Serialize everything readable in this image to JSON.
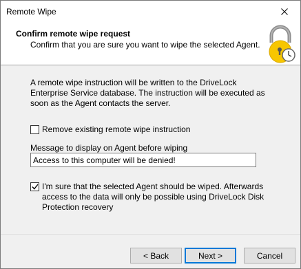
{
  "window": {
    "title": "Remote Wipe",
    "close_icon": "close-icon"
  },
  "header": {
    "title": "Confirm remote wipe request",
    "subtitle": "Confirm that you are sure you want to wipe the selected Agent.",
    "icon": "lock-clock-icon"
  },
  "body": {
    "description": "A remote wipe instruction will be written to the DriveLock Enterprise Service database. The instruction will be executed as soon as the Agent contacts the server.",
    "remove_existing": {
      "label": "Remove existing remote wipe instruction",
      "checked": false
    },
    "message": {
      "label": "Message to display on Agent before wiping",
      "value": "Access to this computer will be denied!"
    },
    "confirm": {
      "label": "I'm sure that the selected Agent should be wiped. Afterwards access to the data will only be possible using DriveLock Disk Protection recovery",
      "checked": true
    }
  },
  "footer": {
    "back_label": "< Back",
    "next_label": "Next >",
    "cancel_label": "Cancel"
  },
  "colors": {
    "accent": "#0078d7",
    "lock_yellow": "#f7c600",
    "lock_gray": "#8c8c8c"
  }
}
